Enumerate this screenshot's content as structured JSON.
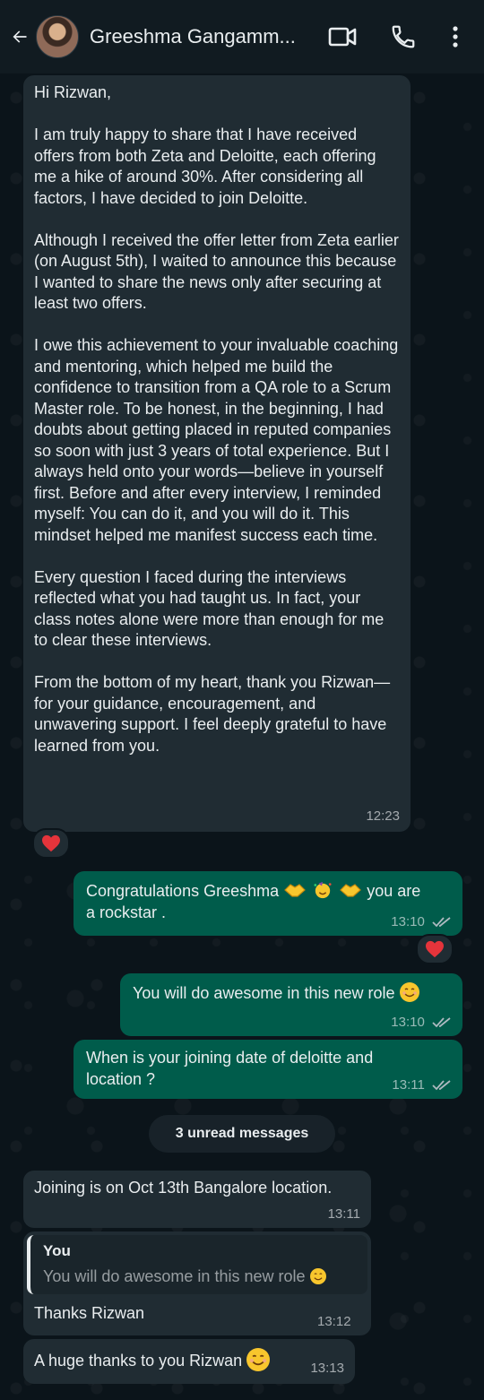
{
  "header": {
    "contact_name": "Greeshma Gangamm...",
    "icons": [
      "back-arrow-icon",
      "video-call-icon",
      "phone-icon",
      "more-vert-icon"
    ]
  },
  "messages": {
    "m1": {
      "p1": "Hi Rizwan,",
      "p2": "I am truly happy to share that I have received offers from both Zeta and Deloitte, each offering me a hike of around 30%. After considering all factors, I have decided to join Deloitte.",
      "p3": "Although I received the offer letter from Zeta earlier (on August 5th), I waited to announce this because I wanted to share the news only after securing at least two offers.",
      "p4": "I owe this achievement to your invaluable coaching and mentoring, which helped me build the confidence to transition from a QA role to a Scrum Master role. To be honest, in the beginning, I had doubts about getting placed in reputed companies so soon with just 3 years of total experience. But I always held onto your words—believe in yourself first. Before and after every interview, I reminded myself: You can do it, and you will do it. This mindset helped me manifest success each time.",
      "p5": "Every question I faced during the interviews reflected what you had taught us. In fact, your class notes alone were more than enough for me to clear these interviews.",
      "p6": "From the bottom of my heart, thank you Rizwan—for your guidance, encouragement, and unwavering support. I feel deeply grateful to have learned from you.",
      "time": "12:23",
      "reaction": "heart-icon"
    },
    "m2": {
      "text_a": "Congratulations Greeshma",
      "text_b": "you are",
      "text_c": "a rockstar .",
      "time": "13:10",
      "reaction": "heart-icon"
    },
    "m3": {
      "text": "You will do awesome in this new role",
      "time": "13:10"
    },
    "m4": {
      "text": "When is your joining date of deloitte and location ?",
      "time": "13:11"
    },
    "unread_label": "3 unread messages",
    "m5": {
      "text": "Joining is on Oct 13th Bangalore location.",
      "time": "13:11"
    },
    "m6": {
      "quote_author": "You",
      "quote_text": "You will do awesome in this new role",
      "text": "Thanks Rizwan",
      "time": "13:12"
    },
    "m7": {
      "text": "A huge thanks to you Rizwan",
      "time": "13:13"
    }
  },
  "colors": {
    "background": "#0b141a",
    "incoming_bubble": "#202c33",
    "outgoing_bubble": "#005c4b",
    "header": "#111b21"
  }
}
